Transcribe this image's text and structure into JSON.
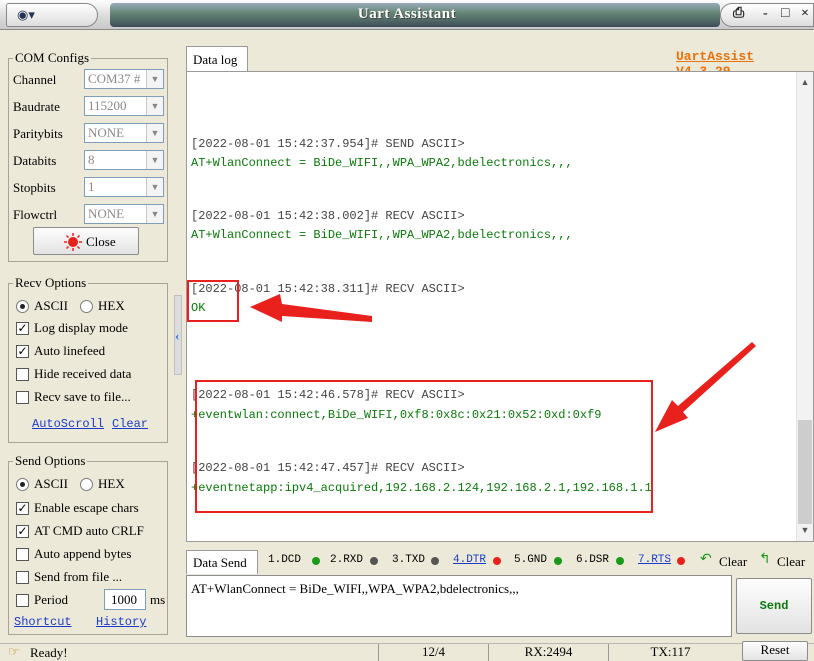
{
  "window": {
    "title": "Uart Assistant",
    "version_link": "UartAssist V4.3.29",
    "system_icon": "app-icon",
    "controls": [
      "-",
      "□",
      "×"
    ]
  },
  "com_configs": {
    "title": "COM Configs",
    "fields": [
      {
        "label": "Channel",
        "value": "COM37 #"
      },
      {
        "label": "Baudrate",
        "value": "115200"
      },
      {
        "label": "Paritybits",
        "value": "NONE"
      },
      {
        "label": "Databits",
        "value": "8"
      },
      {
        "label": "Stopbits",
        "value": "1"
      },
      {
        "label": "Flowctrl",
        "value": "NONE"
      }
    ],
    "close_button": "Close",
    "status_light_color": "#e8211c"
  },
  "recv_options": {
    "title": "Recv Options",
    "radio_ascii": "ASCII",
    "radio_hex": "HEX",
    "selected": "ASCII",
    "checks": [
      {
        "label": "Log display mode",
        "checked": true
      },
      {
        "label": "Auto linefeed",
        "checked": true
      },
      {
        "label": "Hide received data",
        "checked": false
      },
      {
        "label": "Recv save to file...",
        "checked": false
      }
    ],
    "link_autoscroll": "AutoScroll",
    "link_clear": "Clear"
  },
  "send_options": {
    "title": "Send Options",
    "radio_ascii": "ASCII",
    "radio_hex": "HEX",
    "selected": "ASCII",
    "checks": [
      {
        "label": "Enable escape chars",
        "checked": true
      },
      {
        "label": "AT CMD auto CRLF",
        "checked": true
      },
      {
        "label": "Auto append bytes",
        "checked": false
      },
      {
        "label": "Send from file ...",
        "checked": false
      }
    ],
    "period_label": "Period",
    "period_checked": false,
    "period_value": "1000",
    "period_unit": "ms",
    "link_shortcut": "Shortcut",
    "link_history": "History"
  },
  "data_log": {
    "tab_label": "Data log",
    "entries": [
      {
        "header": "[2022-08-01 15:42:37.954]# SEND ASCII>",
        "data": "AT+WlanConnect = BiDe_WIFI,,WPA_WPA2,bdelectronics,,,"
      },
      {
        "header": "[2022-08-01 15:42:38.002]# RECV ASCII>",
        "data": "AT+WlanConnect = BiDe_WIFI,,WPA_WPA2,bdelectronics,,,"
      },
      {
        "header": "[2022-08-01 15:42:38.311]# RECV ASCII>",
        "data": "OK"
      },
      {
        "header": "[2022-08-01 15:42:46.578]# RECV ASCII>",
        "data": "+eventwlan:connect,BiDe_WIFI,0xf8:0x8c:0x21:0x52:0xd:0xf9"
      },
      {
        "header": "[2022-08-01 15:42:47.457]# RECV ASCII>",
        "data": "+eventnetapp:ipv4_acquired,192.168.2.124,192.168.2.1,192.168.1.1"
      }
    ],
    "annotation_color": "#e8211c"
  },
  "data_send": {
    "tab_label": "Data Send",
    "signals": [
      {
        "label": "1.DCD",
        "link": false,
        "dot": "#1a9a1a"
      },
      {
        "label": "2.RXD",
        "link": false,
        "dot": "#555555"
      },
      {
        "label": "3.TXD",
        "link": false,
        "dot": "#555555"
      },
      {
        "label": "4.DTR",
        "link": true,
        "dot": "#e8211c"
      },
      {
        "label": "5.GND",
        "link": false,
        "dot": "#1a9a1a"
      },
      {
        "label": "6.DSR",
        "link": false,
        "dot": "#1a9a1a"
      },
      {
        "label": "7.RTS",
        "link": true,
        "dot": "#e8211c"
      }
    ],
    "clear_down": "Clear",
    "clear_up": "Clear",
    "input_value": "AT+WlanConnect = BiDe_WIFI,,WPA_WPA2,bdelectronics,,,",
    "send_button": "Send"
  },
  "statusbar": {
    "ready": "Ready!",
    "count": "12/4",
    "rx": "RX:2494",
    "tx": "TX:117",
    "reset": "Reset"
  }
}
